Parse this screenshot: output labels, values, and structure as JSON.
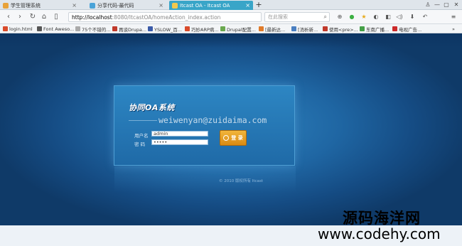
{
  "tabs": [
    {
      "label": "学生管理系统",
      "favicon_color": "#e8a23a"
    },
    {
      "label": "分享代码-最代码",
      "favicon_color": "#4aa3d8"
    },
    {
      "label": "Itcast OA - Itcast OA",
      "favicon_color": "#f2c94c",
      "active": true
    }
  ],
  "new_tab_symbol": "+",
  "window_controls": {
    "user": "♙",
    "minimize": "—",
    "maximize": "▢",
    "close": "✕"
  },
  "nav": {
    "back": "‹",
    "forward": "›",
    "reload": "↻",
    "home": "⌂",
    "reader": "▯",
    "bookmark": "☆"
  },
  "url": {
    "host": "http://localhost",
    "path": ":8080/ItcastOA/homeAction_index.action"
  },
  "search": {
    "placeholder": "在此搜索",
    "icon": "⌕"
  },
  "toolbar_icons": [
    "⊕",
    "●",
    "★",
    "◐",
    "◧",
    "◁)",
    "⬇",
    "↶",
    "≡"
  ],
  "bookmarks": [
    {
      "label": "login.html",
      "color": "#d94b2b"
    },
    {
      "label": "Font Aweso...",
      "color": "#555555"
    },
    {
      "label": "75个不错的...",
      "color": "#aaaaaa"
    },
    {
      "label": "再谈Drupa...",
      "color": "#c0392b"
    },
    {
      "label": "YSLOW_百...",
      "color": "#3b5ba9"
    },
    {
      "label": "巧妙ARP病...",
      "color": "#d94b2b"
    },
    {
      "label": "Drupal配置...",
      "color": "#6aa84f"
    },
    {
      "label": "[最新达...",
      "color": "#e07b2a"
    },
    {
      "label": "[消析新...",
      "color": "#4a7fc1"
    },
    {
      "label": "使用<pre>...",
      "color": "#c0392b"
    },
    {
      "label": "东南广播...",
      "color": "#44a047"
    },
    {
      "label": "电视广告...",
      "color": "#cc2a2a"
    }
  ],
  "bookmarks_more": "»",
  "login": {
    "logo_text": "协同OA系统",
    "watermark": "weiwenyan@zuidaima.com",
    "username_label": "用户名",
    "username_value": "admin",
    "password_label": "密  码",
    "password_value": "•••••",
    "login_button": "登 录"
  },
  "copyright": "© 2010 版权所有 Itcast",
  "brand": {
    "name": "源码海洋网",
    "url": "www.codehy.com"
  }
}
